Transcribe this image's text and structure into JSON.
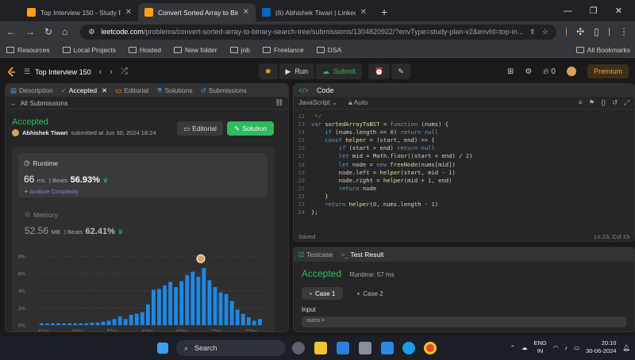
{
  "browser": {
    "tabs": [
      {
        "title": "Top Interview 150 - Study Plan",
        "active": false,
        "favicon": "#ffa116"
      },
      {
        "title": "Convert Sorted Array to Binary",
        "active": true,
        "favicon": "#ffa116"
      },
      {
        "title": "(6) Abhishek Tiwari | LinkedIn",
        "active": false,
        "favicon": "#0a66c2"
      }
    ],
    "url_host": "leetcode.com",
    "url_path": "/problems/convert-sorted-array-to-binary-search-tree/submissions/1304820922/?envType=study-plan-v2&envId=top-in...",
    "bookmarks": [
      "Resources",
      "Local Projects",
      "Hosted",
      "New folder",
      "job",
      "Freelance",
      "DSA"
    ],
    "all_bookmarks": "All Bookmarks"
  },
  "lcnav": {
    "list_title": "Top Interview 150",
    "run_label": "Run",
    "submit_label": "Submit",
    "fire_count": "0",
    "premium_label": "Premium"
  },
  "left": {
    "tabs": [
      "Description",
      "Accepted",
      "Editorial",
      "Solutions",
      "Submissions"
    ],
    "all_submissions": "All Submissions",
    "status": "Accepted",
    "user": "Abhishek Tiwari",
    "submitted_text": "submitted at Jun 30, 2024 18:24",
    "editorial_btn": "Editorial",
    "solution_btn": "Solution",
    "runtime_label": "Runtime",
    "runtime_value": "66",
    "runtime_unit": "ms",
    "beats_label": "Beats",
    "runtime_beats": "56.93%",
    "analyze_label": "Analyze Complexity",
    "memory_label": "Memory",
    "memory_value": "52.56",
    "memory_unit": "MB",
    "memory_beats": "62.41%"
  },
  "chart_data": {
    "type": "bar",
    "y_ticks": [
      "8%",
      "6%",
      "4%",
      "2%",
      "0%"
    ],
    "ylim": [
      0,
      8
    ],
    "x_ticks": [
      "41ms",
      "52ms",
      "57ms",
      "62ms",
      "67ms",
      "72ms",
      "77ms"
    ],
    "values": [
      0.2,
      0.2,
      0.2,
      0.2,
      0.2,
      0.2,
      0.2,
      0.2,
      0.2,
      0.3,
      0.3,
      0.4,
      0.5,
      0.7,
      1.0,
      0.7,
      1.2,
      1.3,
      1.5,
      2.4,
      4.1,
      4.2,
      4.6,
      5.0,
      4.4,
      5.1,
      5.8,
      6.2,
      5.6,
      6.6,
      5.2,
      4.4,
      3.8,
      3.6,
      2.8,
      1.8,
      1.3,
      0.9,
      0.5,
      0.7
    ],
    "highlight_index": 29,
    "bar_color": "#1e88e5"
  },
  "code": {
    "title": "Code",
    "language": "JavaScript",
    "mode": "Auto",
    "saved": "Saved",
    "cursor": "Ln 23, Col 19",
    "lines": [
      {
        "n": "",
        "t": " */"
      },
      {
        "n": "12",
        "t": " */"
      },
      {
        "n": "13",
        "t": "var sortedArrayToBST = function (nums) {"
      },
      {
        "n": "14",
        "t": "    if (nums.length == 0) return null"
      },
      {
        "n": "15",
        "t": "    const helper = (start, end) => {"
      },
      {
        "n": "16",
        "t": "        if (start > end) return null"
      },
      {
        "n": "17",
        "t": "        let mid = Math.floor((start + end) / 2)"
      },
      {
        "n": "18",
        "t": "        let node = new TreeNode(nums[mid])"
      },
      {
        "n": "19",
        "t": "        node.left = helper(start, mid - 1)"
      },
      {
        "n": "20",
        "t": "        node.right = helper(mid + 1, end)"
      },
      {
        "n": "21",
        "t": "        return node"
      },
      {
        "n": "22",
        "t": "    }"
      },
      {
        "n": "23",
        "t": "    return helper(0, nums.length - 1)"
      },
      {
        "n": "24",
        "t": "};"
      }
    ]
  },
  "test": {
    "testcase_tab": "Testcase",
    "result_tab": "Test Result",
    "status": "Accepted",
    "runtime": "Runtime: 57 ms",
    "cases": [
      "Case 1",
      "Case 2"
    ],
    "input_label": "Input",
    "input_value": "nums ="
  },
  "taskbar": {
    "search": "Search",
    "lang1": "ENG",
    "lang2": "IN",
    "time": "20:10",
    "date": "30-06-2024"
  }
}
